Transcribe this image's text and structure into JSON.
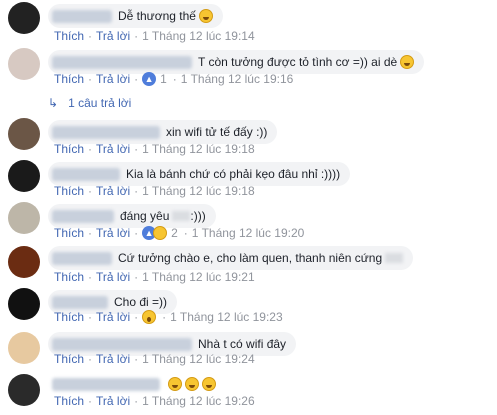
{
  "actions": {
    "like": "Thích",
    "reply": "Trả lời",
    "sep": "·"
  },
  "reply_summary": "1 câu trả lời",
  "comments": [
    {
      "text": "Dễ thương thế",
      "emoji": "haha-emoji",
      "time": "1 Tháng 12 lúc 19:14",
      "reactions": ""
    },
    {
      "text": "T còn tưởng được tỏ tình cơ =)) ai dè",
      "emoji": "laugh-tear-emoji",
      "time": "1 Tháng 12 lúc 19:16",
      "reactions": "1",
      "reaction_icon": "like-icon"
    },
    {
      "text": "xin wifi tử tế đấy :))",
      "time": "1 Tháng 12 lúc 19:18",
      "reactions": ""
    },
    {
      "text": "Kia là bánh chứ có phải kẹo đâu nhỉ :))))",
      "time": "1 Tháng 12 lúc 19:18",
      "reactions": ""
    },
    {
      "text": "đáng yêu",
      "text_after": ":)))",
      "time": "1 Tháng 12 lúc 19:20",
      "reactions": "2",
      "reaction_icon": "like-haha-icons"
    },
    {
      "text": "Cứ tưởng chào e, cho làm quen, thanh niên cứng",
      "time": "1 Tháng 12 lúc 19:21",
      "reactions": ""
    },
    {
      "text": "Cho đi =))",
      "time": "1 Tháng 12 lúc 19:23",
      "reactions": "",
      "reaction_icon": "wow-icon"
    },
    {
      "text": "Nhà t có wifi đây",
      "time": "1 Tháng 12 lúc 19:24",
      "reactions": ""
    },
    {
      "text": "",
      "emoji_count": 3,
      "time": "1 Tháng 12 lúc 19:26",
      "reactions": ""
    }
  ]
}
